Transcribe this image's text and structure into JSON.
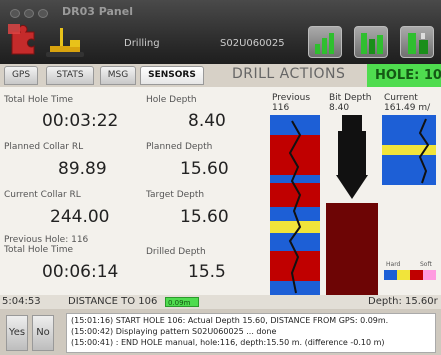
{
  "header": {
    "app_title": "DR03 Panel",
    "status": "Drilling",
    "pattern_id": "S02U060025"
  },
  "tabs": [
    {
      "label": "GPS"
    },
    {
      "label": "STATS"
    },
    {
      "label": "MSG"
    },
    {
      "label": "SENSORS"
    }
  ],
  "drill_actions_label": "DRILL ACTIONS",
  "hole_badge": "HOLE: 10",
  "stats": {
    "total_hole_time": {
      "label": "Total Hole Time",
      "value": "00:03:22"
    },
    "hole_depth": {
      "label": "Hole Depth",
      "value": "8.40"
    },
    "planned_collar_rl": {
      "label": "Planned Collar RL",
      "value": "89.89"
    },
    "planned_depth": {
      "label": "Planned Depth",
      "value": "15.60"
    },
    "current_collar_rl": {
      "label": "Current Collar RL",
      "value": "244.00"
    },
    "target_depth": {
      "label": "Target Depth",
      "value": "15.60"
    },
    "prev_hole_line1": "Previous Hole: 116",
    "prev_hole_line2": "Total Hole Time",
    "prev_total_hole_time": "00:06:14",
    "drilled_depth": {
      "label": "Drilled Depth",
      "value": "15.5"
    }
  },
  "logs": {
    "previous_label": "Previous",
    "previous_value": "116",
    "bit_depth_label": "Bit Depth",
    "bit_depth_value": "8.40",
    "current_label": "Current",
    "current_value": "161.49 m/",
    "legend_hard": "Hard",
    "legend_soft": "Soft"
  },
  "status_row": {
    "time": "5:04:53",
    "distance_label": "DISTANCE TO 106",
    "distance_value": "0.09m",
    "depth": "Depth: 15.60r"
  },
  "bottom": {
    "yes_label": "Yes",
    "no_label": "No",
    "log_lines": [
      "(15:01:16) START HOLE 106: Actual Depth 15.60, DISTANCE FROM GPS: 0.09m.",
      "(15:00:42) Displaying pattern S02U060025 ... done",
      "(15:00:41) : END HOLE manual, hole:116, depth:15.50 m. (difference -0.10 m)"
    ]
  },
  "colors": {
    "accent_green": "#4fdc4f",
    "stratum_red": "#c00000",
    "stratum_blue": "#1d5fd6",
    "stratum_yellow": "#f1e43a"
  }
}
